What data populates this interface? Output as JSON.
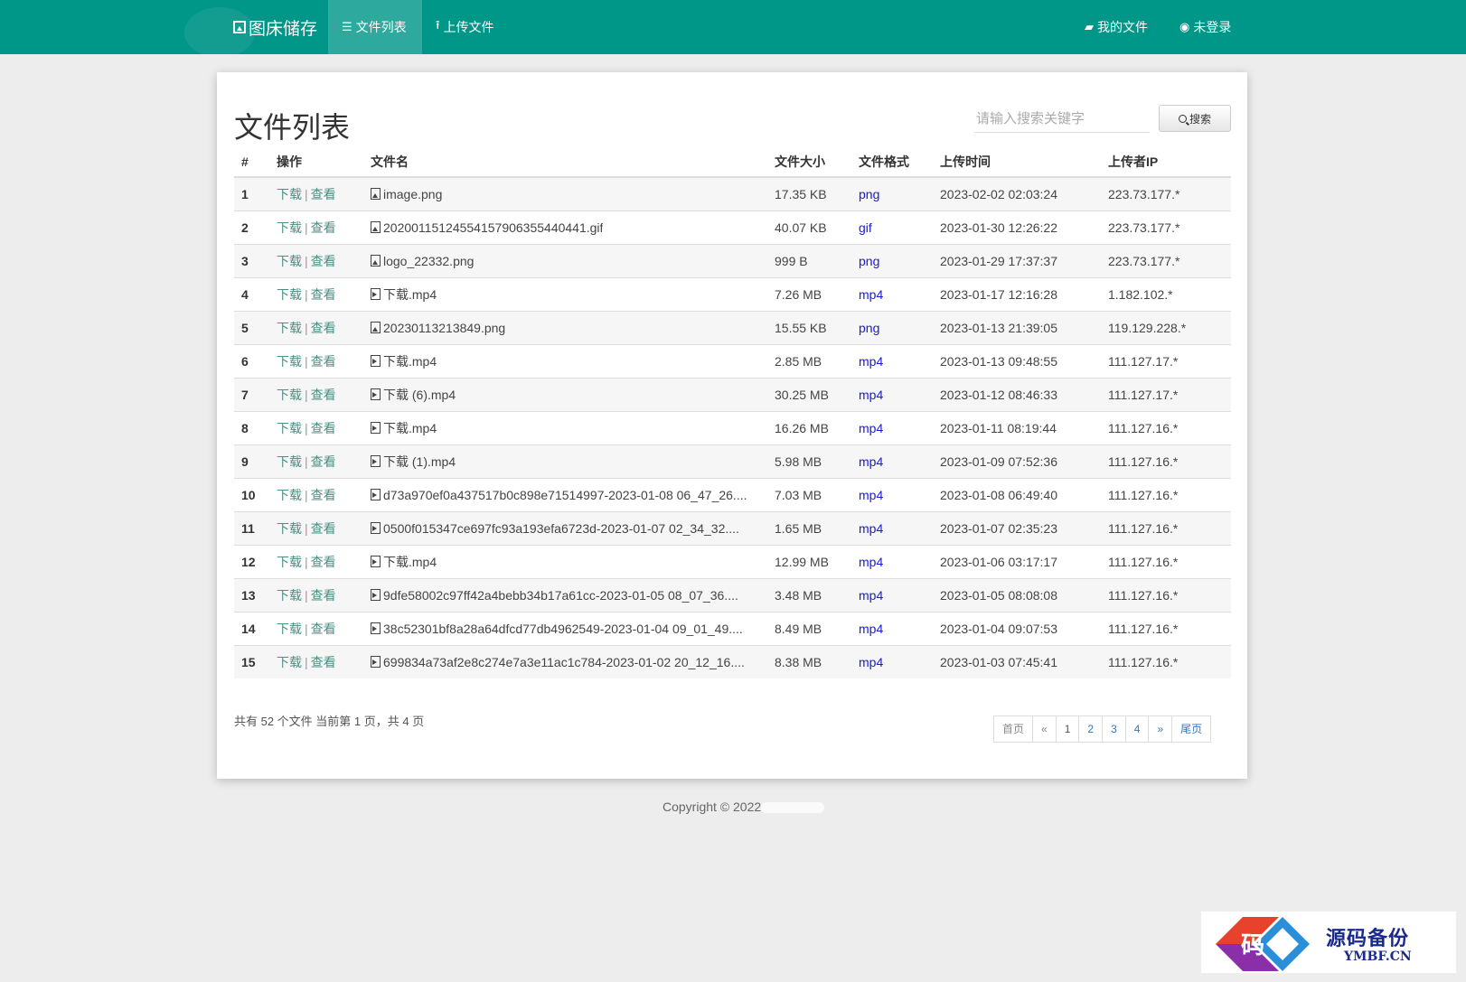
{
  "navbar": {
    "brand": "图床储存",
    "items": [
      {
        "label": "文件列表",
        "icon": "list-icon"
      },
      {
        "label": "上传文件",
        "icon": "upload-icon"
      }
    ],
    "right": [
      {
        "label": "我的文件",
        "icon": "folder-icon"
      },
      {
        "label": "未登录",
        "icon": "user-circle-icon"
      }
    ]
  },
  "main": {
    "title": "文件列表",
    "search": {
      "placeholder": "请输入搜索关键字",
      "button_label": "搜索"
    },
    "table": {
      "headers": [
        "#",
        "操作",
        "文件名",
        "文件大小",
        "文件格式",
        "上传时间",
        "上传者IP"
      ],
      "action_labels": {
        "download": "下载",
        "separator": "|",
        "view": "查看"
      },
      "rows": [
        {
          "num": "1",
          "name": "image.png",
          "size": "17.35 KB",
          "format": "png",
          "time": "2023-02-02 02:03:24",
          "ip": "223.73.177.*",
          "icon": "image-file-icon"
        },
        {
          "num": "2",
          "name": "20200115124554157906355440441.gif",
          "size": "40.07 KB",
          "format": "gif",
          "time": "2023-01-30 12:26:22",
          "ip": "223.73.177.*",
          "icon": "image-file-icon"
        },
        {
          "num": "3",
          "name": "logo_22332.png",
          "size": "999 B",
          "format": "png",
          "time": "2023-01-29 17:37:37",
          "ip": "223.73.177.*",
          "icon": "image-file-icon"
        },
        {
          "num": "4",
          "name": "下载.mp4",
          "size": "7.26 MB",
          "format": "mp4",
          "time": "2023-01-17 12:16:28",
          "ip": "1.182.102.*",
          "icon": "video-file-icon"
        },
        {
          "num": "5",
          "name": "20230113213849.png",
          "size": "15.55 KB",
          "format": "png",
          "time": "2023-01-13 21:39:05",
          "ip": "119.129.228.*",
          "icon": "image-file-icon"
        },
        {
          "num": "6",
          "name": "下载.mp4",
          "size": "2.85 MB",
          "format": "mp4",
          "time": "2023-01-13 09:48:55",
          "ip": "111.127.17.*",
          "icon": "video-file-icon"
        },
        {
          "num": "7",
          "name": "下载 (6).mp4",
          "size": "30.25 MB",
          "format": "mp4",
          "time": "2023-01-12 08:46:33",
          "ip": "111.127.17.*",
          "icon": "video-file-icon"
        },
        {
          "num": "8",
          "name": "下载.mp4",
          "size": "16.26 MB",
          "format": "mp4",
          "time": "2023-01-11 08:19:44",
          "ip": "111.127.16.*",
          "icon": "video-file-icon"
        },
        {
          "num": "9",
          "name": "下载 (1).mp4",
          "size": "5.98 MB",
          "format": "mp4",
          "time": "2023-01-09 07:52:36",
          "ip": "111.127.16.*",
          "icon": "video-file-icon"
        },
        {
          "num": "10",
          "name": "d73a970ef0a437517b0c898e71514997-2023-01-08 06_47_26....",
          "size": "7.03 MB",
          "format": "mp4",
          "time": "2023-01-08 06:49:40",
          "ip": "111.127.16.*",
          "icon": "video-file-icon"
        },
        {
          "num": "11",
          "name": "0500f015347ce697fc93a193efa6723d-2023-01-07 02_34_32....",
          "size": "1.65 MB",
          "format": "mp4",
          "time": "2023-01-07 02:35:23",
          "ip": "111.127.16.*",
          "icon": "video-file-icon"
        },
        {
          "num": "12",
          "name": "下载.mp4",
          "size": "12.99 MB",
          "format": "mp4",
          "time": "2023-01-06 03:17:17",
          "ip": "111.127.16.*",
          "icon": "video-file-icon"
        },
        {
          "num": "13",
          "name": "9dfe58002c97ff42a4bebb34b17a61cc-2023-01-05 08_07_36....",
          "size": "3.48 MB",
          "format": "mp4",
          "time": "2023-01-05 08:08:08",
          "ip": "111.127.16.*",
          "icon": "video-file-icon"
        },
        {
          "num": "14",
          "name": "38c52301bf8a28a64dfcd77db4962549-2023-01-04 09_01_49....",
          "size": "8.49 MB",
          "format": "mp4",
          "time": "2023-01-04 09:07:53",
          "ip": "111.127.16.*",
          "icon": "video-file-icon"
        },
        {
          "num": "15",
          "name": "699834a73af2e8c274e7a3e11ac1c784-2023-01-02 20_12_16....",
          "size": "8.38 MB",
          "format": "mp4",
          "time": "2023-01-03 07:45:41",
          "ip": "111.127.16.*",
          "icon": "video-file-icon"
        }
      ]
    },
    "summary": "共有 52 个文件  当前第 1 页，共 4 页",
    "pagination": [
      "首页",
      "«",
      "1",
      "2",
      "3",
      "4",
      "»",
      "尾页"
    ]
  },
  "footer": {
    "copyright": "Copyright © 2022"
  },
  "watermark": {
    "title": "源码备份",
    "subtitle": "YMBF.CN",
    "emblem_char": "码"
  },
  "colors": {
    "navbar": "#009688",
    "link": "#4a8f83",
    "format": "#1a1acc",
    "pager_link": "#337ab7"
  }
}
